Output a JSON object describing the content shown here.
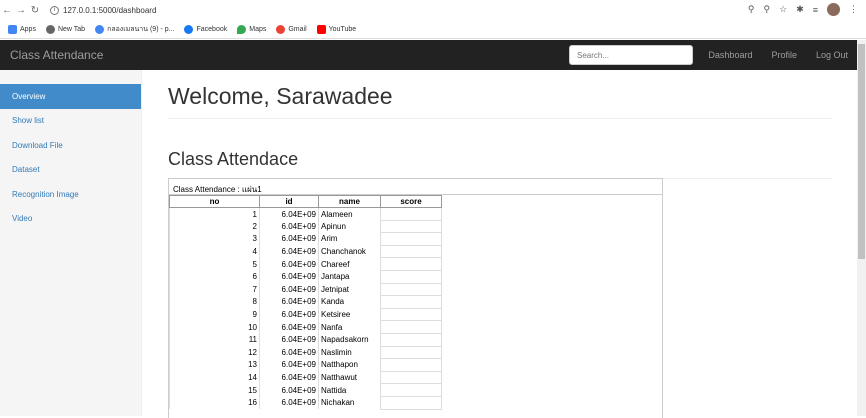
{
  "browser": {
    "url": "127.0.0.1:5000/dashboard",
    "bookmarks": [
      "Apps",
      "New Tab",
      "กลองเมลนาน (9) - p...",
      "Facebook",
      "Maps",
      "Gmail",
      "YouTube"
    ]
  },
  "navbar": {
    "brand": "Class Attendance",
    "search_placeholder": "Search...",
    "links": [
      "Dashboard",
      "Profile",
      "Log Out"
    ]
  },
  "sidebar": {
    "items": [
      "Overview",
      "Show list",
      "Download File",
      "Dataset",
      "Recognition Image",
      "Video"
    ]
  },
  "main": {
    "welcome": "Welcome, Sarawadee",
    "section_title": "Class Attendace",
    "sheet_title": "Class Attendance : แผ่น1",
    "columns": [
      "no",
      "id",
      "name",
      "score"
    ],
    "rows": [
      [
        "1",
        "6.04E+09",
        "Alameen",
        ""
      ],
      [
        "2",
        "6.04E+09",
        "Apinun",
        ""
      ],
      [
        "3",
        "6.04E+09",
        "Arim",
        ""
      ],
      [
        "4",
        "6.04E+09",
        "Chanchanok",
        ""
      ],
      [
        "5",
        "6.04E+09",
        "Chareef",
        ""
      ],
      [
        "6",
        "6.04E+09",
        "Jantapa",
        ""
      ],
      [
        "7",
        "6.04E+09",
        "Jetnipat",
        ""
      ],
      [
        "8",
        "6.04E+09",
        "Kanda",
        ""
      ],
      [
        "9",
        "6.04E+09",
        "Ketsiree",
        ""
      ],
      [
        "10",
        "6.04E+09",
        "Nanfa",
        ""
      ],
      [
        "11",
        "6.04E+09",
        "Napadsakorn",
        ""
      ],
      [
        "12",
        "6.04E+09",
        "Naslimin",
        ""
      ],
      [
        "13",
        "6.04E+09",
        "Natthapon",
        ""
      ],
      [
        "14",
        "6.04E+09",
        "Natthawut",
        ""
      ],
      [
        "15",
        "6.04E+09",
        "Nattida",
        ""
      ],
      [
        "16",
        "6.04E+09",
        "Nichakan",
        ""
      ]
    ]
  },
  "colors": {
    "navbar": "#222222",
    "sidebar_active": "#428bca",
    "link": "#337ab7"
  }
}
